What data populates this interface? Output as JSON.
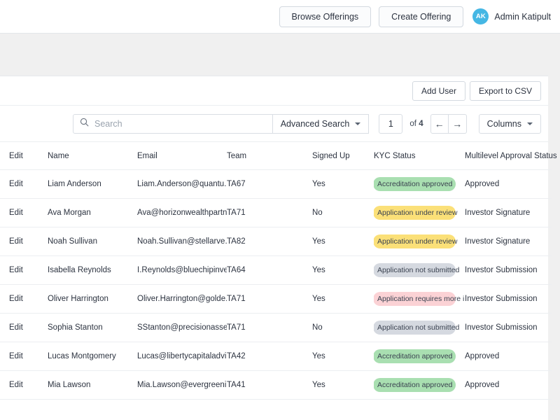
{
  "topbar": {
    "browse_offerings_label": "Browse Offerings",
    "create_offering_label": "Create Offering",
    "user_initials": "AK",
    "user_name": "Admin Katipult"
  },
  "actions": {
    "add_user_label": "Add User",
    "export_csv_label": "Export to CSV"
  },
  "toolbar": {
    "search_placeholder": "Search",
    "search_value": "",
    "advanced_search_label": "Advanced Search",
    "page_value": "1",
    "of_label": "of",
    "total_pages": "4",
    "prev_arrow": "←",
    "next_arrow": "→",
    "columns_label": "Columns"
  },
  "table": {
    "columns": [
      "Edit",
      "Name",
      "Email",
      "Team",
      "Signed Up",
      "KYC Status",
      "Multilevel Approval Status"
    ],
    "rows": [
      {
        "edit": "Edit",
        "name": "Liam Anderson",
        "email": "Liam.Anderson@quantu...",
        "team": "TA67",
        "signed_up": "Yes",
        "kyc_status": "Accreditation approved",
        "kyc_variant": "green",
        "approval_status": "Approved"
      },
      {
        "edit": "Edit",
        "name": "Ava Morgan",
        "email": "Ava@horizonwealthpartn...",
        "team": "TA71",
        "signed_up": "No",
        "kyc_status": "Application under review",
        "kyc_variant": "yellow",
        "approval_status": "Investor Signature"
      },
      {
        "edit": "Edit",
        "name": "Noah Sullivan",
        "email": "Noah.Sullivan@stellarve...",
        "team": "TA82",
        "signed_up": "Yes",
        "kyc_status": "Application under review",
        "kyc_variant": "yellow",
        "approval_status": "Investor Signature"
      },
      {
        "edit": "Edit",
        "name": "Isabella Reynolds",
        "email": "I.Reynolds@bluechipinve...",
        "team": "TA64",
        "signed_up": "Yes",
        "kyc_status": "Application not submitted",
        "kyc_variant": "gray",
        "approval_status": "Investor Submission"
      },
      {
        "edit": "Edit",
        "name": "Oliver Harrington",
        "email": "Oliver.Harrington@golde...",
        "team": "TA71",
        "signed_up": "Yes",
        "kyc_status": "Application requires more information",
        "kyc_variant": "pink",
        "approval_status": "Investor Submission"
      },
      {
        "edit": "Edit",
        "name": "Sophia Stanton",
        "email": "SStanton@precisionasse...",
        "team": "TA71",
        "signed_up": "No",
        "kyc_status": "Application not submitted",
        "kyc_variant": "gray",
        "approval_status": "Investor Submission"
      },
      {
        "edit": "Edit",
        "name": "Lucas Montgomery",
        "email": "Lucas@libertycapitaladvi...",
        "team": "TA42",
        "signed_up": "Yes",
        "kyc_status": "Accreditation approved",
        "kyc_variant": "green",
        "approval_status": "Approved"
      },
      {
        "edit": "Edit",
        "name": "Mia Lawson",
        "email": "Mia.Lawson@evergreeni...",
        "team": "TA41",
        "signed_up": "Yes",
        "kyc_status": "Accreditation approved",
        "kyc_variant": "green",
        "approval_status": "Approved"
      }
    ]
  },
  "colors": {
    "avatar": "#45b7e4",
    "badge_green": "#a9dfb1",
    "badge_yellow": "#fbe078",
    "badge_gray": "#d5d9e0",
    "badge_pink": "#fbd2d5",
    "page_background": "#f0f0f0"
  }
}
